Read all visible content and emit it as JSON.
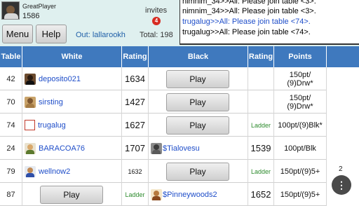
{
  "player": {
    "name": "GreatPlayer",
    "rating": "1586"
  },
  "invites": {
    "label": "invites",
    "count": "4"
  },
  "buttons": {
    "menu": "Menu",
    "help": "Help"
  },
  "status": {
    "out": "Out: lallarookh",
    "total": "Total: 198"
  },
  "chat": [
    {
      "text": "nimnim_34>>All: Please join table <3>.",
      "color": "#222222"
    },
    {
      "text": "nimnim_34>>All: Please join table <3>.",
      "color": "#222222"
    },
    {
      "text": "trugalug>>All: Please join table <74>.",
      "color": "#1f4ec9"
    },
    {
      "text": "trugalug>>All: Please join table <74>.",
      "color": "#222222"
    }
  ],
  "columns": {
    "table": "Table",
    "white": "White",
    "rating": "Rating",
    "black": "Black",
    "rating2": "Rating",
    "points": "Points"
  },
  "rows": [
    {
      "table": "42",
      "white": "deposito021",
      "white_rating": "1634",
      "black": "",
      "black_rating": "",
      "points": "150pt/\n(9)Drw*",
      "play_label": "Play"
    },
    {
      "table": "70",
      "white": "sirsting",
      "white_rating": "1427",
      "black": "",
      "black_rating": "",
      "points": "150pt/\n(9)Drw*",
      "play_label": "Play"
    },
    {
      "table": "74",
      "white": "trugalug",
      "white_rating": "1627",
      "black": "",
      "black_rating": "Ladder",
      "points": "100pt/(9)Blk*",
      "play_label": "Play"
    },
    {
      "table": "24",
      "white": "BARACOA76",
      "white_rating": "1707",
      "black": "$Tialovesu",
      "black_rating": "1539",
      "points": "100pt/Blk"
    },
    {
      "table": "79",
      "white": "wellnow2",
      "white_rating": "1632",
      "black": "",
      "black_rating": "Ladder",
      "points": "150pt/(9)5+",
      "play_label": "Play"
    },
    {
      "table": "87",
      "white": "",
      "white_rating": "Ladder",
      "black": "$Pinneywoods2",
      "black_rating": "1652",
      "points": "150pt/(9)5+",
      "play_label": "Play"
    }
  ],
  "fab_icon": "more-vertical-icon",
  "page_indicator": "2",
  "colors": {
    "header": "#3f79be",
    "link": "#1f4ec9",
    "ladder": "#2e8b2e",
    "badge": "#d72c22",
    "top_bg": "#dff0ef"
  }
}
